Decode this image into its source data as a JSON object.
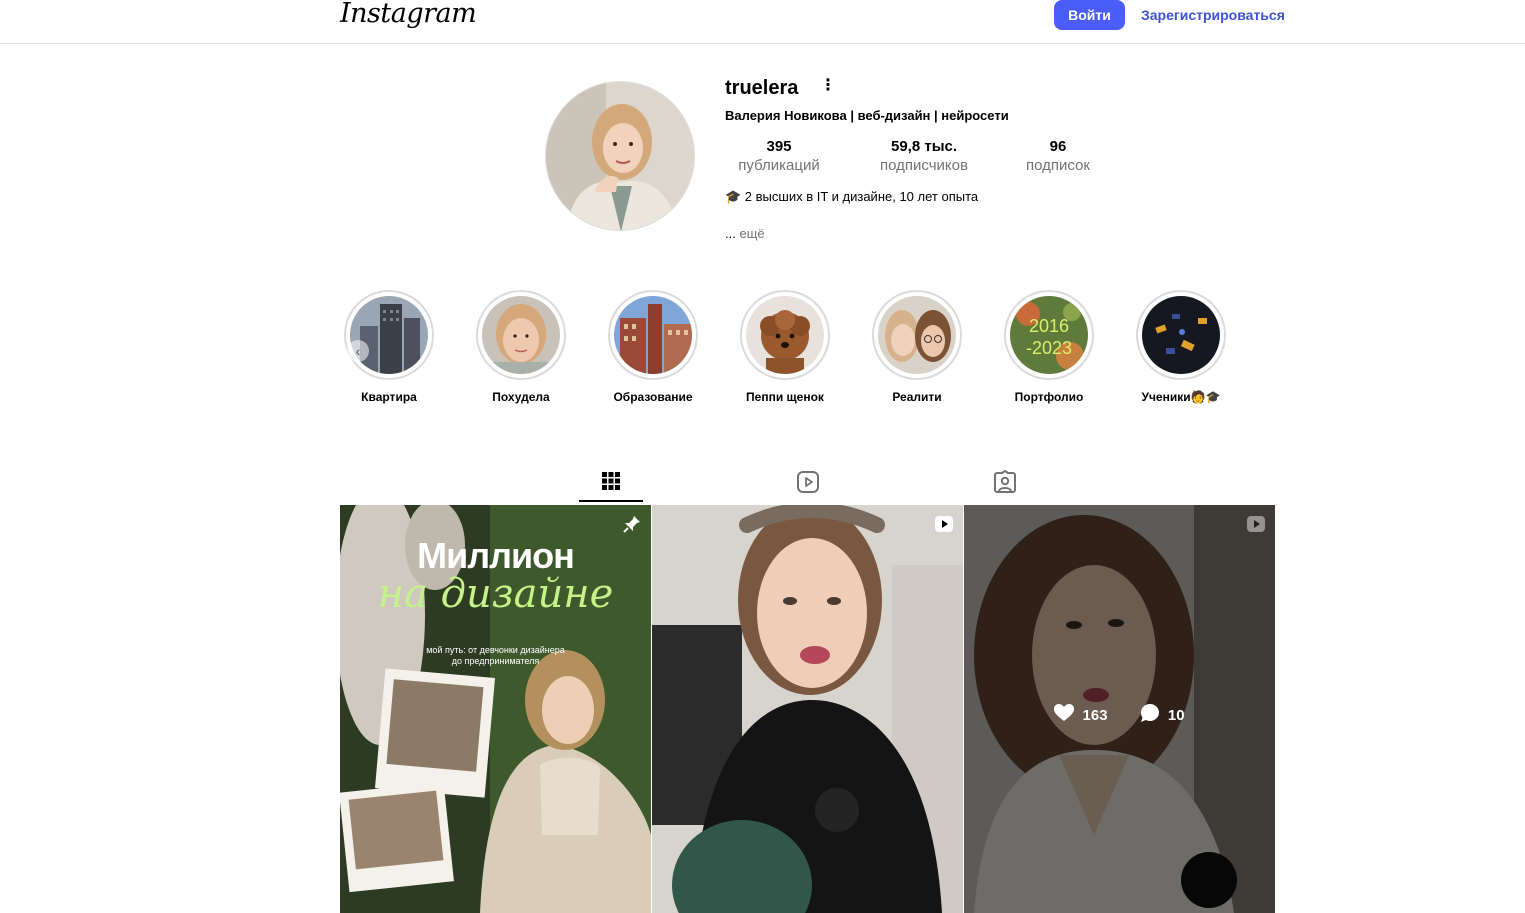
{
  "header": {
    "logo": "Instagram",
    "login_label": "Войти",
    "signup_label": "Зарегистрироваться"
  },
  "profile": {
    "username": "truelera",
    "full_name": "Валерия Новикова | веб-дизайн | нейросети",
    "stats": [
      {
        "value": "395",
        "label": "публикаций"
      },
      {
        "value": "59,8 тыс.",
        "label": "подписчиков"
      },
      {
        "value": "96",
        "label": "подписок"
      }
    ],
    "bio": "🎓 2 высших в IT и дизайне, 10 лет опыта",
    "more_dots": "...",
    "more_label": "ещё"
  },
  "highlights": [
    {
      "label": "Квартира"
    },
    {
      "label": "Похудела"
    },
    {
      "label": "Образование"
    },
    {
      "label": "Пеппи щенок"
    },
    {
      "label": "Реалити"
    },
    {
      "label": "Портфолио",
      "overlay_text": "2016\n-2023"
    },
    {
      "label": "Ученики🧑🎓"
    }
  ],
  "tabs": [
    {
      "icon": "grid-icon",
      "active": true
    },
    {
      "icon": "reels-icon",
      "active": false
    },
    {
      "icon": "tagged-icon",
      "active": false
    }
  ],
  "posts": [
    {
      "type": "pinned",
      "cover_title": "Миллион",
      "cover_script": "на дизайне",
      "cover_subtitle_1": "мой путь: от девчонки дизайнера",
      "cover_subtitle_2": "до предпринимателя"
    },
    {
      "type": "reel"
    },
    {
      "type": "reel",
      "hovered": true,
      "likes": "163",
      "comments": "10"
    }
  ]
}
